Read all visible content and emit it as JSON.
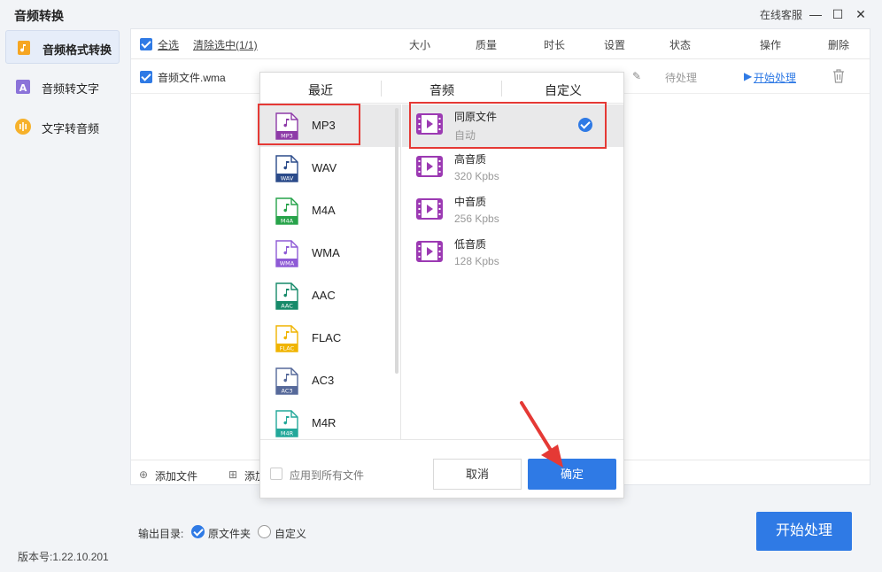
{
  "app": {
    "title": "音频转换",
    "service_link": "在线客服",
    "version": "版本号:1.22.10.201"
  },
  "sidebar": {
    "items": [
      {
        "label": "音频格式转换",
        "icon": "audio-file-icon",
        "active": true
      },
      {
        "label": "音频转文字",
        "icon": "text-image-icon",
        "active": false
      },
      {
        "label": "文字转音频",
        "icon": "waveform-icon",
        "active": false
      }
    ]
  },
  "table": {
    "select_all": "全选",
    "clear_selected": "清除选中(1/1)",
    "columns": [
      "大小",
      "质量",
      "时长",
      "设置",
      "状态",
      "操作",
      "删除"
    ],
    "rows": [
      {
        "file": "音频文件.wma",
        "status": "待处理",
        "action": "开始处理"
      }
    ],
    "footer": {
      "add_file": "添加文件",
      "add_folder": "添加"
    }
  },
  "output": {
    "label": "输出目录:",
    "option_original": "原文件夹",
    "option_custom": "自定义"
  },
  "start_button": "开始处理",
  "dialog": {
    "tabs": [
      "最近",
      "音频",
      "自定义"
    ],
    "formats": [
      {
        "name": "MP3",
        "color": "#8e3ba8",
        "selected": true
      },
      {
        "name": "WAV",
        "color": "#2b4b8a",
        "selected": false
      },
      {
        "name": "M4A",
        "color": "#27a34a",
        "selected": false
      },
      {
        "name": "WMA",
        "color": "#8f5bd6",
        "selected": false
      },
      {
        "name": "AAC",
        "color": "#178a6a",
        "selected": false
      },
      {
        "name": "FLAC",
        "color": "#f0b400",
        "selected": false
      },
      {
        "name": "AC3",
        "color": "#56699a",
        "selected": false
      },
      {
        "name": "M4R",
        "color": "#23a89a",
        "selected": false
      }
    ],
    "qualities": [
      {
        "name": "同原文件",
        "sub": "自动",
        "selected": true
      },
      {
        "name": "高音质",
        "sub": "320 Kpbs",
        "selected": false
      },
      {
        "name": "中音质",
        "sub": "256 Kpbs",
        "selected": false
      },
      {
        "name": "低音质",
        "sub": "128 Kpbs",
        "selected": false
      }
    ],
    "apply_all": "应用到所有文件",
    "cancel": "取消",
    "ok": "确定"
  },
  "colors": {
    "accent": "#2f7ae5",
    "highlight_box": "#e53935",
    "video_icon": "#9c3ab3"
  }
}
